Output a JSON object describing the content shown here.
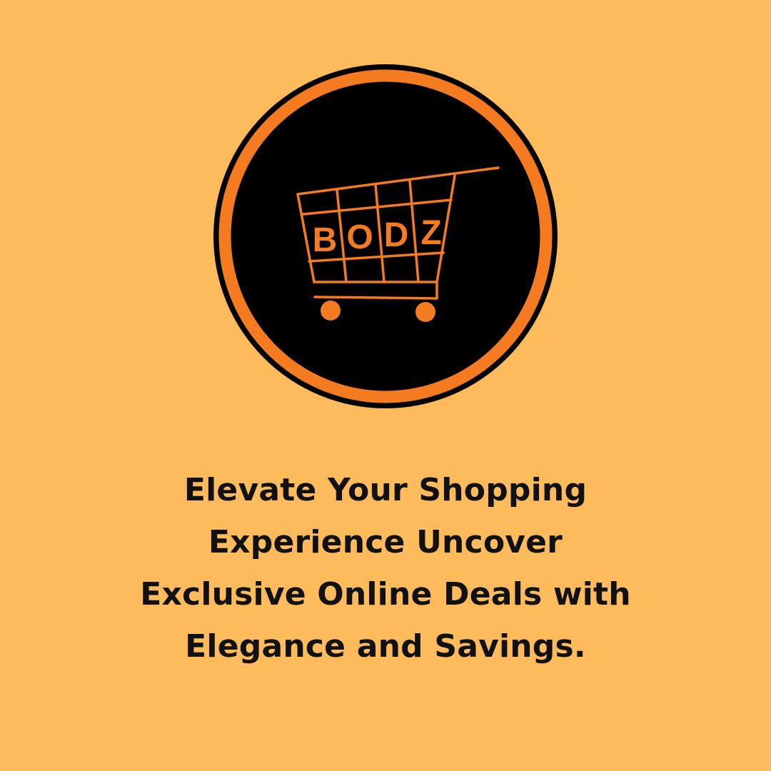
{
  "logo": {
    "brand": [
      "B",
      "O",
      "D",
      "Z"
    ],
    "colors": {
      "orange": "#f47b20",
      "black": "#000000",
      "background": "#fdbb5b"
    }
  },
  "tagline": {
    "lines": [
      "Elevate Your Shopping",
      "Experience Uncover",
      "Exclusive Online Deals with",
      "Elegance and Savings."
    ]
  }
}
